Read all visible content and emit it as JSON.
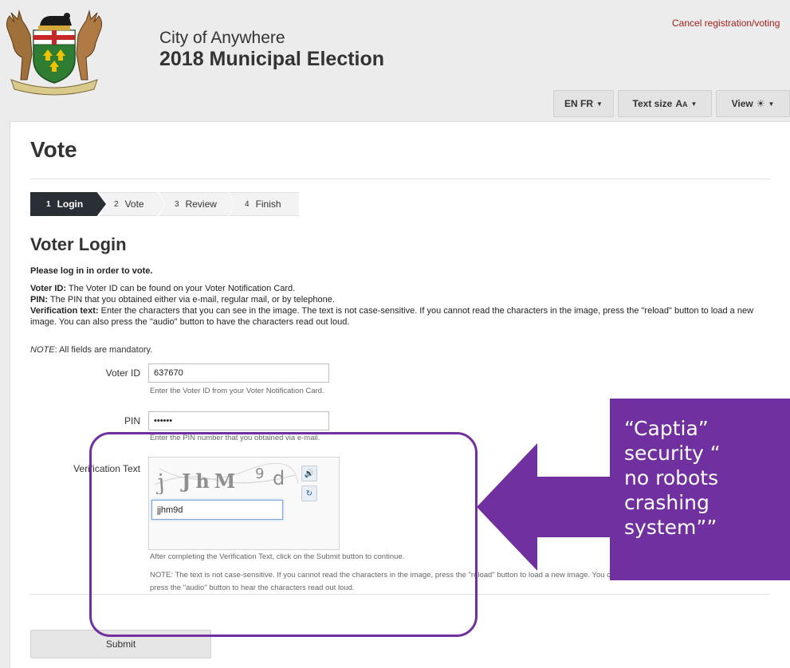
{
  "header": {
    "city": "City of Anywhere",
    "election": "2018 Municipal Election",
    "cancel_link": "Cancel registration/voting",
    "lang_button": "EN FR",
    "text_size_button": "Text size",
    "text_size_glyph": "A",
    "text_size_glyph_small": "A",
    "view_button": "View"
  },
  "page": {
    "title": "Vote",
    "steps": [
      {
        "num": "1",
        "label": "Login"
      },
      {
        "num": "2",
        "label": "Vote"
      },
      {
        "num": "3",
        "label": "Review"
      },
      {
        "num": "4",
        "label": "Finish"
      }
    ],
    "section_title": "Voter Login",
    "intro": "Please log in in order to vote.",
    "voter_id_term": "Voter ID:",
    "voter_id_desc": " The Voter ID can be found on your Voter Notification Card.",
    "pin_term": "PIN:",
    "pin_desc": " The PIN that you obtained either via e-mail, regular mail, or by telephone.",
    "verif_term": "Verification text:",
    "verif_desc": " Enter the characters that you can see in the image. The text is not case-sensitive. If you cannot read the characters in the image, press the \"reload\" button to load a new image. You can also press the \"audio\" button to have the characters read out loud.",
    "note_label": "NOTE",
    "note_text": ": All fields are mandatory."
  },
  "form": {
    "voter_id_label": "Voter ID",
    "voter_id_value": "637670",
    "voter_id_help": "Enter the Voter ID from your Voter Notification Card.",
    "pin_label": "PIN",
    "pin_value": "••••••",
    "pin_help": "Enter the PIN number that you obtained via e-mail.",
    "verification_label": "Verification Text",
    "captcha_text": "jJhM9d",
    "captcha_input_value": "jjhm9d",
    "after_help": "After completing the Verification Text, click on the Submit button to continue.",
    "note_help_1": "NOTE: The text is not case-sensitive. If you cannot read the characters in the image, press the \"reload\" button to load a new image. You can also",
    "note_help_2": "press the \"audio\" button to hear the characters read out loud.",
    "submit_label": "Submit"
  },
  "annotation": {
    "lines": [
      "“Captia”",
      "security “",
      "no robots",
      "crashing",
      "system””"
    ],
    "color": "#7030a0"
  },
  "icons": {
    "audio": "audio-icon",
    "reload": "reload-icon",
    "view": "sun-icon",
    "crest": "crest-logo"
  }
}
